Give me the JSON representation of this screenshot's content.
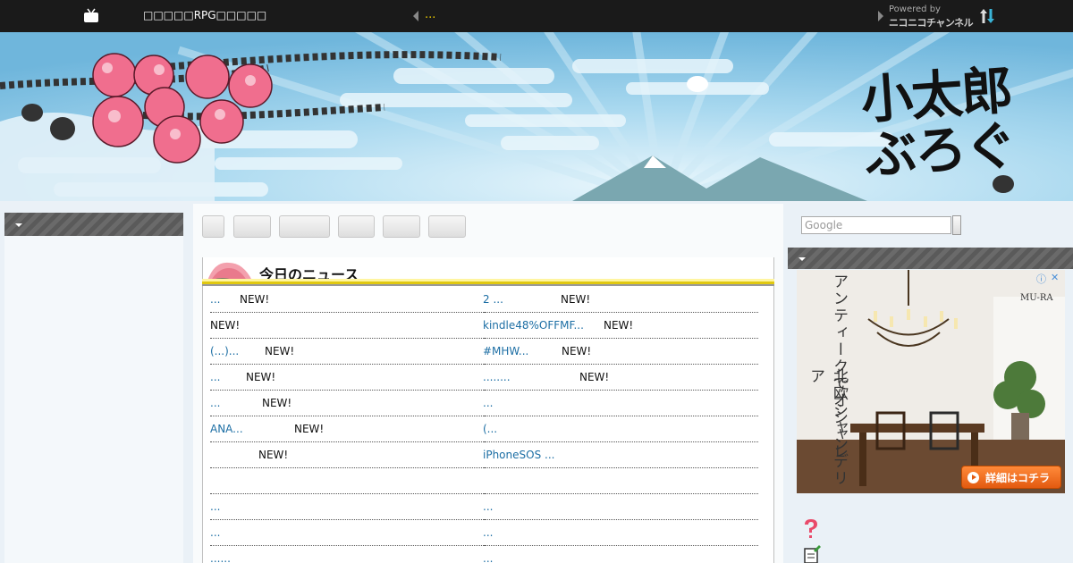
{
  "topbar": {
    "title": "□□□□□RPG□□□□□",
    "link": "...",
    "powered_by": "Powered by",
    "brand": "ニコニコチャンネル"
  },
  "banner": {
    "logo_line1": "小太郎",
    "logo_line2": "ぶろぐ"
  },
  "news": {
    "title": "今日のニュース",
    "new_label": "NEW!",
    "left": [
      {
        "text": "...",
        "new": true
      },
      {
        "text": "",
        "new": true
      },
      {
        "text": "(...)...",
        "new": true
      },
      {
        "text": "...",
        "new": true
      },
      {
        "text": " ...",
        "new": true
      },
      {
        "text": "ANA...",
        "new": true
      },
      {
        "text": "",
        "new": true
      },
      {
        "text": "",
        "new": false
      },
      {
        "text": "...",
        "new": false
      },
      {
        "text": "...",
        "new": false
      },
      {
        "text": "......",
        "new": false
      }
    ],
    "right": [
      {
        "text": "2 ...",
        "new": true
      },
      {
        "text": "kindle48%OFFMF...",
        "new": true
      },
      {
        "text": "#MHW...",
        "new": true
      },
      {
        "text": "........",
        "new": true
      },
      {
        "text": "...",
        "new": false
      },
      {
        "text": "(...",
        "new": false
      },
      {
        "text": "iPhoneSOS ...",
        "new": false
      },
      {
        "text": "",
        "new": false
      },
      {
        "text": "...",
        "new": false
      },
      {
        "text": " ...",
        "new": false
      },
      {
        "text": "...",
        "new": false
      }
    ]
  },
  "search": {
    "placeholder": "Google"
  },
  "ad": {
    "line1": "アンティークでオシャレ",
    "line2": "北欧シャンデリア",
    "brand": "MU-RA",
    "button": "詳細はコチラ",
    "close": "✕",
    "info": "ⓘ"
  },
  "colors": {
    "topbar": "#1a1a1a",
    "link": "#1c6ea4",
    "accent": "#e8c800"
  }
}
